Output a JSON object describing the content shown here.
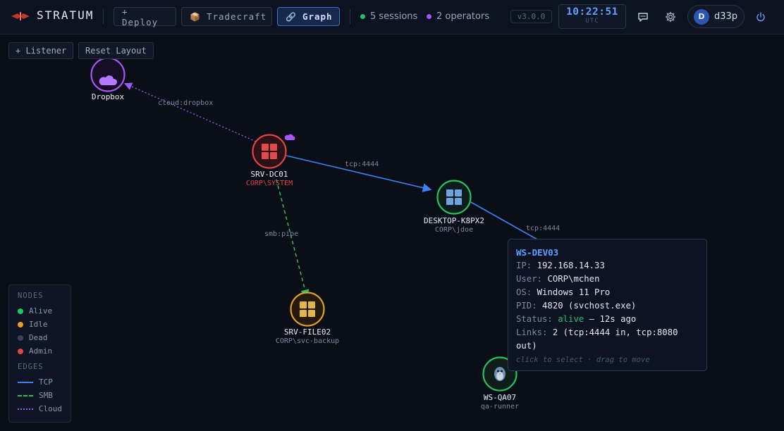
{
  "app": {
    "brand": "STRATUM",
    "nav": [
      {
        "label": "+ Deploy",
        "icon": "plus-icon",
        "active": false
      },
      {
        "label": "Tradecraft",
        "icon": "package-icon",
        "active": false
      },
      {
        "label": "Graph",
        "icon": "link-icon",
        "active": true
      }
    ],
    "sessions": "5 sessions",
    "operators": "2 operators",
    "version": "v3.0.0",
    "clock": {
      "time": "10:22:51",
      "tz": "UTC"
    },
    "user": {
      "initial": "D",
      "name": "d33p"
    },
    "icons": [
      "chat-icon",
      "gear-icon",
      "power-icon"
    ]
  },
  "colors": {
    "accent": "#5ea1ff",
    "tcp": "#3b82f6",
    "smb": "#22c55e",
    "cloud": "#9b59f5",
    "alive": "#22c55e",
    "idle": "#e0a12b",
    "dead": "#3a4559",
    "admin": "#e24545"
  },
  "toolbar": {
    "listener": "+ Listener",
    "reset": "Reset Layout"
  },
  "nodes": [
    {
      "id": "dropbox",
      "name": "Dropbox",
      "sub": "",
      "kind": "cloud",
      "status": "cloud",
      "icon": "cloud-icon"
    },
    {
      "id": "srv-dc01",
      "name": "SRV-DC01",
      "sub": "CORP\\SYSTEM",
      "kind": "windows",
      "status": "admin",
      "icon": "windows-icon"
    },
    {
      "id": "desktop-k8px2",
      "name": "DESKTOP-K8PX2",
      "sub": "CORP\\jdoe",
      "kind": "windows",
      "status": "alive",
      "icon": "windows-icon"
    },
    {
      "id": "srv-file02",
      "name": "SRV-FILE02",
      "sub": "CORP\\svc-backup",
      "kind": "windows",
      "status": "idle",
      "icon": "windows-icon"
    },
    {
      "id": "ws-qa07",
      "name": "WS-QA07",
      "sub": "qa-runner",
      "kind": "linux",
      "status": "alive",
      "icon": "linux-icon"
    }
  ],
  "edges": [
    {
      "label": "cloud:dropbox",
      "type": "cloud"
    },
    {
      "label": "tcp:4444",
      "type": "tcp"
    },
    {
      "label": "smb:pipe",
      "type": "smb"
    },
    {
      "label": "tcp:4444",
      "type": "tcp"
    }
  ],
  "legend": {
    "nodes_title": "NODES",
    "nodes": [
      {
        "label": "Alive",
        "color": "#22c55e"
      },
      {
        "label": "Idle",
        "color": "#e0a12b"
      },
      {
        "label": "Dead",
        "color": "#3a4559"
      },
      {
        "label": "Admin",
        "color": "#e24545"
      }
    ],
    "edges_title": "EDGES",
    "edges": [
      {
        "label": "TCP",
        "style": "solid",
        "color": "#3b82f6"
      },
      {
        "label": "SMB",
        "style": "dashed",
        "color": "#22c55e"
      },
      {
        "label": "Cloud",
        "style": "dotted",
        "color": "#9b59f5"
      }
    ]
  },
  "tooltip": {
    "title": "WS-DEV03",
    "ip_key": "IP:",
    "ip": "192.168.14.33",
    "user_key": "User:",
    "user": "CORP\\mchen",
    "os_key": "OS:",
    "os": "Windows 11 Pro",
    "pid_key": "PID:",
    "pid": "4820 (svchost.exe)",
    "status_key": "Status:",
    "status": "alive",
    "status_ago": "– 12s ago",
    "links_key": "Links:",
    "links": "2 (tcp:4444 in, tcp:8080 out)",
    "hint": "click to select · drag to move"
  }
}
